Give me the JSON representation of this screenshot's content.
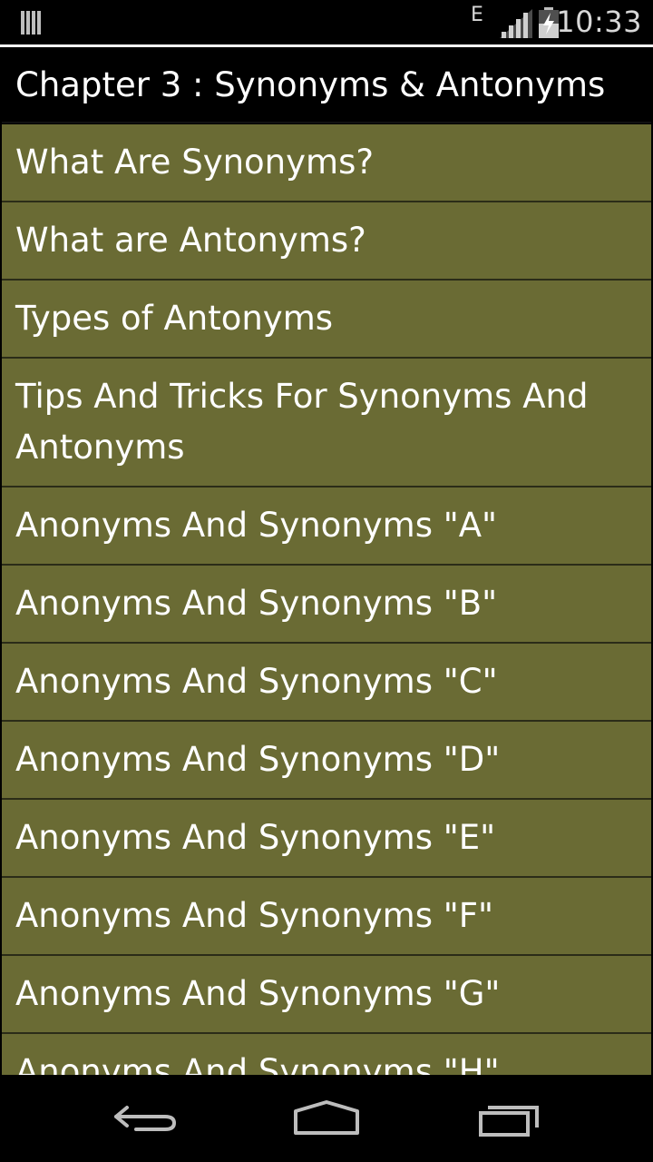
{
  "status_bar": {
    "network_type": "E",
    "time": "10:33",
    "icons": [
      "notification-icon",
      "signal-icon",
      "battery-charging-icon"
    ]
  },
  "header": {
    "title": "Chapter 3 : Synonyms & Antonyms"
  },
  "topics": [
    "What Are Synonyms?",
    "What are Antonyms?",
    "Types of Antonyms",
    "Tips And Tricks For Synonyms And Antonyms",
    "Anonyms And Synonyms \"A\"",
    "Anonyms And Synonyms \"B\"",
    "Anonyms And Synonyms \"C\"",
    "Anonyms And Synonyms \"D\"",
    "Anonyms And Synonyms \"E\"",
    "Anonyms And Synonyms \"F\"",
    "Anonyms And Synonyms \"G\"",
    "Anonyms And Synonyms \"H\""
  ],
  "colors": {
    "list_background": "#6a6b34",
    "divider": "#2b2c18",
    "header_background": "#000000",
    "text": "#ffffff"
  },
  "nav_bar": {
    "icons": [
      "back-icon",
      "home-icon",
      "recents-icon"
    ]
  }
}
